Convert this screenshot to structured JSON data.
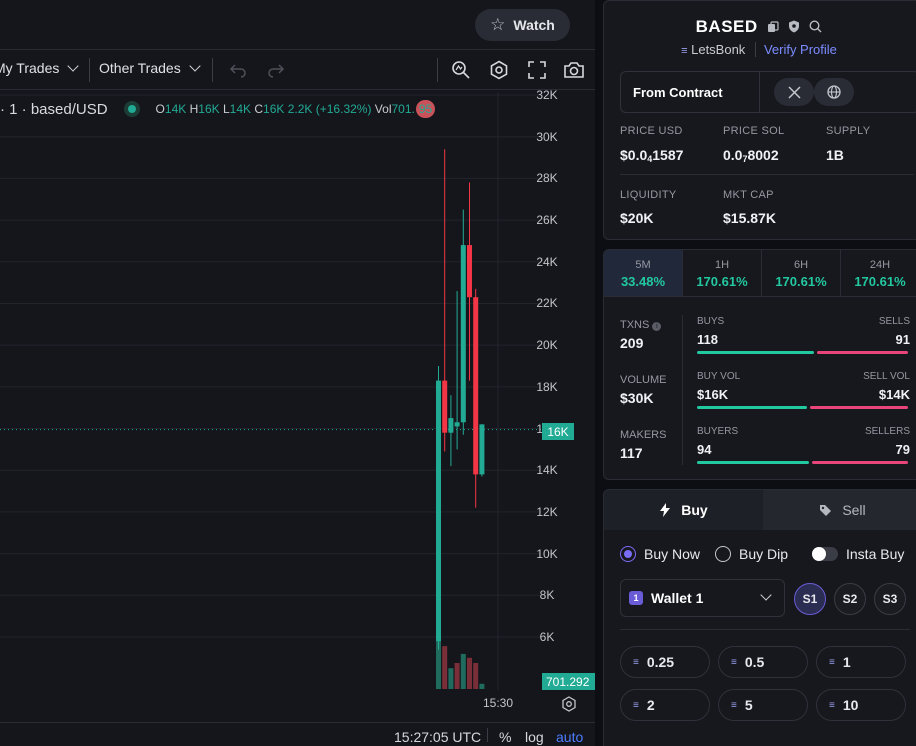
{
  "header": {
    "watch_label": "Watch"
  },
  "toolbar": {
    "my_trades": "My Trades",
    "other_trades": "Other Trades"
  },
  "legend": {
    "symbol": "· 1 · based/USD",
    "o_label": "O",
    "o": "14K",
    "h_label": "H",
    "h": "16K",
    "l_label": "L",
    "l": "14K",
    "c_label": "C",
    "c": "16K",
    "change": "2.2K (+16.32%)",
    "vol_label": "Vol",
    "vol": "701.",
    "vol_tail": "95"
  },
  "chart_data": {
    "type": "candlestick",
    "y_ticks": [
      "32K",
      "30K",
      "28K",
      "26K",
      "24K",
      "22K",
      "20K",
      "18K",
      "16K",
      "14K",
      "12K",
      "10K",
      "8K",
      "6K"
    ],
    "ylim": [
      5000,
      32500
    ],
    "x_tick": "15:30",
    "current_price_label": "16K",
    "current_price": 15950,
    "volume_label": "701.292",
    "candles": [
      {
        "o": 5800,
        "h": 19000,
        "l": 5400,
        "c": 18300
      },
      {
        "o": 18300,
        "h": 29400,
        "l": 14900,
        "c": 15800
      },
      {
        "o": 15800,
        "h": 17600,
        "l": 14200,
        "c": 16500
      },
      {
        "o": 16100,
        "h": 22600,
        "l": 15000,
        "c": 16300
      },
      {
        "o": 16300,
        "h": 26500,
        "l": 15700,
        "c": 24800
      },
      {
        "o": 24800,
        "h": 27800,
        "l": 18300,
        "c": 22300
      },
      {
        "o": 22300,
        "h": 22700,
        "l": 12200,
        "c": 13800
      },
      {
        "o": 13800,
        "h": 16200,
        "l": 13700,
        "c": 16200
      }
    ],
    "volumes": [
      0.58,
      0.33,
      0.16,
      0.2,
      0.27,
      0.24,
      0.2,
      0.04
    ],
    "volume_colors": [
      "green",
      "red",
      "green",
      "red",
      "green",
      "red",
      "red",
      "green"
    ]
  },
  "bottom_bar": {
    "time": "15:27:05 UTC",
    "percent": "%",
    "log": "log",
    "auto": "auto"
  },
  "token": {
    "name": "BASED",
    "launchpad": "LetsBonk",
    "verify": "Verify Profile",
    "from_contract": "From Contract",
    "price_usd_label": "PRICE USD",
    "price_usd_a": "$0.0",
    "price_usd_sub": "4",
    "price_usd_b": "1587",
    "price_sol_label": "PRICE SOL",
    "price_sol_a": "0.0",
    "price_sol_sub": "7",
    "price_sol_b": "8002",
    "supply_label": "SUPPLY",
    "supply": "1B",
    "liquidity_label": "LIQUIDITY",
    "liquidity": "$20K",
    "mktcap_label": "MKT CAP",
    "mktcap": "$15.87K"
  },
  "timeframes": [
    {
      "name": "5M",
      "value": "33.48%"
    },
    {
      "name": "1H",
      "value": "170.61%"
    },
    {
      "name": "6H",
      "value": "170.61%"
    },
    {
      "name": "24H",
      "value": "170.61%"
    }
  ],
  "txns": {
    "txns_label": "TXNS",
    "txns": "209",
    "volume_label": "VOLUME",
    "volume": "$30K",
    "makers_label": "MAKERS",
    "makers": "117",
    "buys_label": "BUYS",
    "buys": "118",
    "sells_label": "SELLS",
    "sells": "91",
    "buyvol_label": "BUY VOL",
    "buyvol": "$16K",
    "sellvol_label": "SELL VOL",
    "sellvol": "$14K",
    "buyers_label": "BUYERS",
    "buyers": "94",
    "sellers_label": "SELLERS",
    "sellers": "79",
    "buys_frac": 0.56,
    "buyvol_frac": 0.53,
    "buyers_frac": 0.54
  },
  "trade": {
    "buy_tab": "Buy",
    "sell_tab": "Sell",
    "buy_now": "Buy Now",
    "buy_dip": "Buy Dip",
    "insta_buy": "Insta Buy",
    "wallet": "Wallet 1",
    "wallet_badge": "1",
    "slots": [
      "S1",
      "S2",
      "S3"
    ],
    "amounts": [
      "0.25",
      "0.5",
      "1",
      "2",
      "5",
      "10"
    ],
    "sol_glyph": "≡"
  },
  "colors": {
    "up": "#22ab94",
    "down": "#f23645",
    "accent": "#7b6cf6"
  }
}
